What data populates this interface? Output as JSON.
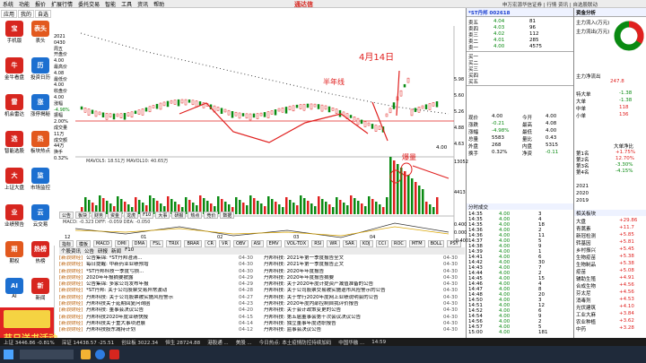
{
  "menubar": {
    "items": [
      "系统",
      "功能",
      "报价",
      "扩展行情",
      "委托交易",
      "智能",
      "工具",
      "资讯",
      "帮助"
    ],
    "brand": "通达信",
    "center": "A股资讯中心",
    "right": "申万宏源华信证券 | 行情 资讯 | 自选股联动"
  },
  "appbar": {
    "tabs": [
      "应用",
      "我的",
      "自选"
    ],
    "apps": [
      {
        "label": "手机版",
        "icon": "宝"
      },
      {
        "label": "表头",
        "icon": "表头"
      },
      {
        "label": "金牛看盘",
        "icon": "牛"
      },
      {
        "label": "投资日历",
        "icon": "历"
      },
      {
        "label": "机会雷达",
        "icon": "雷"
      },
      {
        "label": "涨停揭秘",
        "icon": "涨"
      },
      {
        "label": "智能选股",
        "icon": "选"
      },
      {
        "label": "板块热点",
        "icon": "热"
      },
      {
        "label": "上证大盘",
        "icon": "大"
      },
      {
        "label": "市场监控",
        "icon": "监"
      },
      {
        "label": "业绩预告",
        "icon": "业"
      },
      {
        "label": "云交易",
        "icon": "云"
      },
      {
        "label": "期权",
        "icon": "期"
      },
      {
        "label": "热榜",
        "icon": "热榜"
      },
      {
        "label": "AI",
        "icon": "AI"
      },
      {
        "label": "新闻",
        "icon": "新"
      }
    ],
    "ad_title": "节日送书活动"
  },
  "chart": {
    "annotation_date": "4月14日",
    "annotation_halfyear": "半年线",
    "annotation_volume": "爆量",
    "ma_line": "MAVOL5: 18.51万   MAVOL10: 40.65万",
    "macd_line": "MACD: -0.323   DIFF: -0.059   DEA: -0.050",
    "vol_ticks": [
      "13052",
      "4413"
    ],
    "price_ticks": [
      "5.98",
      "5.60",
      "5.26",
      "4.88",
      "4.63"
    ],
    "price_low_label": "4.00",
    "macd_ticks": [
      "0.400",
      "0.000",
      "-0.400"
    ],
    "x_labels": [
      "12",
      "01",
      "02",
      "03",
      "04"
    ],
    "info": [
      "2021",
      "0430",
      "周五",
      "开盘价",
      "4.00",
      "最高价",
      "4.08",
      "最低价",
      "4.00",
      "收盘价",
      "4.00",
      "涨幅",
      "-4.98%",
      "振幅",
      "2.00%",
      "成交量",
      "11万",
      "成交额",
      "44万",
      "换手",
      "0.32%"
    ]
  },
  "toolbar": {
    "items": [
      "公告",
      "板块",
      "财务",
      "资金",
      "龙虎",
      "F10",
      "大事",
      "研报",
      "热点",
      "竞价",
      "数据"
    ]
  },
  "indicator_tabs": [
    "指标",
    "模板",
    "MACD",
    "DMI",
    "DMA",
    "FSL",
    "TRIX",
    "BRAR",
    "CR",
    "VR",
    "OBV",
    "ASI",
    "EMV",
    "VOL-TDX",
    "RSI",
    "WR",
    "SAR",
    "KDJ",
    "CCI",
    "ROC",
    "MTM",
    "BOLL",
    "PSY"
  ],
  "news": {
    "tabs": [
      "个股资讯",
      "公告",
      "研报",
      "新闻",
      "F10"
    ],
    "left": [
      {
        "tag": "[新浪财经]",
        "title": "公告集锦: *ST丹邦澄清...",
        "date": "04-30"
      },
      {
        "tag": "[新浪财经]",
        "title": "每日提醒: 中新药业业绩预增",
        "date": "04-30"
      },
      {
        "tag": "[新浪财经]",
        "title": "*ST丹邦科技一季度亏损...",
        "date": "04-30"
      },
      {
        "tag": "[新浪财经]",
        "title": "2020年年报摘要披露",
        "date": "04-29"
      },
      {
        "tag": "[新浪财经]",
        "title": "公告集锦: 多家公司发布年报",
        "date": "04-29"
      },
      {
        "tag": "[新浪财经]",
        "title": "*ST丹邦: 关于公司股票交易异常波动",
        "date": "04-28"
      },
      {
        "tag": "[新浪财经]",
        "title": "丹邦科技: 关于公司股票被实施风险警示",
        "date": "04-27"
      },
      {
        "tag": "[新浪财经]",
        "title": "丹邦科技关于延期回复问询函",
        "date": "04-23"
      },
      {
        "tag": "[新浪财经]",
        "title": "丹邦科技: 董事会决议公告",
        "date": "04-20"
      },
      {
        "tag": "[新浪财经]",
        "title": "丹邦科技2020年度业绩快报",
        "date": "04-15"
      },
      {
        "tag": "[新浪财经]",
        "title": "丹邦科技关于重大事项进展",
        "date": "04-14"
      },
      {
        "tag": "[新浪财经]",
        "title": "丹邦科技股东减持计划",
        "date": "04-12"
      }
    ],
    "right": [
      {
        "title": "丹邦科技: 2021年第一季度报告全文",
        "date": "04-30"
      },
      {
        "title": "丹邦科技: 2021年第一季度报告正文",
        "date": "04-30"
      },
      {
        "title": "丹邦科技: 2020年年度报告",
        "date": "04-30"
      },
      {
        "title": "丹邦科技: 2020年年度报告摘要",
        "date": "04-30"
      },
      {
        "title": "丹邦科技: 关于2020年度计提资产减值准备的公告",
        "date": "04-30"
      },
      {
        "title": "丹邦科技: 关于公司股票交易被实施退市风险警示的公告",
        "date": "04-30"
      },
      {
        "title": "丹邦科技: 关于举行2020年度网上业绩说明会的公告",
        "date": "04-30"
      },
      {
        "title": "丹邦科技: 2020年度内部控制自我评价报告",
        "date": "04-30"
      },
      {
        "title": "丹邦科技: 关于会计政策变更的公告",
        "date": "04-30"
      },
      {
        "title": "丹邦科技: 第五届董事会第十次会议决议公告",
        "date": "04-30"
      },
      {
        "title": "丹邦科技: 独立董事年度述职报告",
        "date": "04-30"
      },
      {
        "title": "丹邦科技: 监事会决议公告",
        "date": "04-30"
      }
    ]
  },
  "statusbar": {
    "items": [
      "上证 3446.86 -0.81%",
      "深证 14438.57 -25.51",
      "创业板 3022.34",
      "恒生 28724.88",
      "港股通 ...",
      "美股 ...",
      "今日热点: 本土疫情防控持续加码",
      "中国华融 ...",
      "14:59"
    ]
  },
  "quote": {
    "title": "*ST丹邦 002618",
    "asks": [
      {
        "label": "卖五",
        "price": "4.04",
        "vol": "81"
      },
      {
        "label": "卖四",
        "price": "4.03",
        "vol": "96"
      },
      {
        "label": "卖三",
        "price": "4.02",
        "vol": "112"
      },
      {
        "label": "卖二",
        "price": "4.01",
        "vol": "285"
      },
      {
        "label": "卖一",
        "price": "4.00",
        "vol": "4575"
      }
    ],
    "bids": [
      {
        "label": "买一",
        "price": "",
        "vol": ""
      },
      {
        "label": "买二",
        "price": "",
        "vol": ""
      },
      {
        "label": "买三",
        "price": "",
        "vol": ""
      },
      {
        "label": "买四",
        "price": "",
        "vol": ""
      },
      {
        "label": "买五",
        "price": "",
        "vol": ""
      }
    ],
    "stats": [
      {
        "k": "现价",
        "v": "4.00"
      },
      {
        "k": "今开",
        "v": "4.00"
      },
      {
        "k": "涨跌",
        "v": "-0.21"
      },
      {
        "k": "最高",
        "v": "4.08"
      },
      {
        "k": "涨幅",
        "v": "-4.98%"
      },
      {
        "k": "最低",
        "v": "4.00"
      },
      {
        "k": "总量",
        "v": "5583"
      },
      {
        "k": "量比",
        "v": "0.43"
      },
      {
        "k": "外盘",
        "v": "268"
      },
      {
        "k": "内盘",
        "v": "5315"
      },
      {
        "k": "换手",
        "v": "0.32%"
      },
      {
        "k": "净资",
        "v": "-0.11"
      }
    ],
    "ticks_header": "分时成交",
    "ticks": [
      {
        "t": "14:35",
        "p": "4.00",
        "v": "3"
      },
      {
        "t": "14:35",
        "p": "4.00",
        "v": "4"
      },
      {
        "t": "14:35",
        "p": "4.00",
        "v": "18"
      },
      {
        "t": "14:36",
        "p": "4.00",
        "v": "2"
      },
      {
        "t": "14:36",
        "p": "4.00",
        "v": "11"
      },
      {
        "t": "14:37",
        "p": "4.00",
        "v": "5"
      },
      {
        "t": "14:38",
        "p": "4.00",
        "v": "9"
      },
      {
        "t": "14:39",
        "p": "4.00",
        "v": "1"
      },
      {
        "t": "14:41",
        "p": "4.00",
        "v": "6"
      },
      {
        "t": "14:42",
        "p": "4.00",
        "v": "30"
      },
      {
        "t": "14:43",
        "p": "4.00",
        "v": "7"
      },
      {
        "t": "14:44",
        "p": "4.00",
        "v": "2"
      },
      {
        "t": "14:45",
        "p": "4.00",
        "v": "15"
      },
      {
        "t": "14:46",
        "p": "4.00",
        "v": "4"
      },
      {
        "t": "14:47",
        "p": "4.00",
        "v": "8"
      },
      {
        "t": "14:48",
        "p": "4.00",
        "v": "20"
      },
      {
        "t": "14:50",
        "p": "4.00",
        "v": "3"
      },
      {
        "t": "14:51",
        "p": "4.00",
        "v": "12"
      },
      {
        "t": "14:52",
        "p": "4.00",
        "v": "6"
      },
      {
        "t": "14:54",
        "p": "4.00",
        "v": "9"
      },
      {
        "t": "14:56",
        "p": "4.00",
        "v": "2"
      },
      {
        "t": "14:57",
        "p": "4.00",
        "v": "5"
      },
      {
        "t": "15:00",
        "p": "4.00",
        "v": "181"
      }
    ]
  },
  "fund": {
    "title": "资金分析",
    "legend": [
      "主力流入(万元)",
      "主力流出(万元)",
      "主力净流出"
    ],
    "net_in": "247.8",
    "flows": [
      {
        "k": "特大单",
        "v": "-1.38"
      },
      {
        "k": "大单",
        "v": "-1.38"
      },
      {
        "k": "中单",
        "v": "118"
      },
      {
        "k": "小单",
        "v": "136"
      }
    ],
    "rank_header": "大单净比",
    "ranks": [
      {
        "k": "第1名",
        "v": "+1.75%"
      },
      {
        "k": "第2名",
        "v": "12.70%"
      },
      {
        "k": "第3名",
        "v": "-3.30%"
      },
      {
        "k": "第4名",
        "v": "-4.15%"
      }
    ],
    "years": [
      "2021",
      "2020",
      "2019"
    ],
    "sector_header": "相关板块",
    "sectors": [
      {
        "k": "大盘",
        "v": "+29.86"
      },
      {
        "k": "青蒿素",
        "v": "+11.7"
      },
      {
        "k": "新冠检测",
        "v": "+5.85"
      },
      {
        "k": "转基因",
        "v": "+5.81"
      },
      {
        "k": "乡村振兴",
        "v": "+5.45"
      },
      {
        "k": "生物疫苗",
        "v": "+5.38"
      },
      {
        "k": "生物制品",
        "v": "+5.38"
      },
      {
        "k": "疫苗",
        "v": "+5.08"
      },
      {
        "k": "辅助生殖",
        "v": "+4.91"
      },
      {
        "k": "合成生物",
        "v": "+4.56"
      },
      {
        "k": "芬太尼",
        "v": "+4.56"
      },
      {
        "k": "消毒剂",
        "v": "+4.53"
      },
      {
        "k": "光伏建筑",
        "v": "+4.10"
      },
      {
        "k": "工业大麻",
        "v": "+3.84"
      },
      {
        "k": "农业种植",
        "v": "+3.62"
      },
      {
        "k": "中药",
        "v": "+3.28"
      }
    ]
  }
}
